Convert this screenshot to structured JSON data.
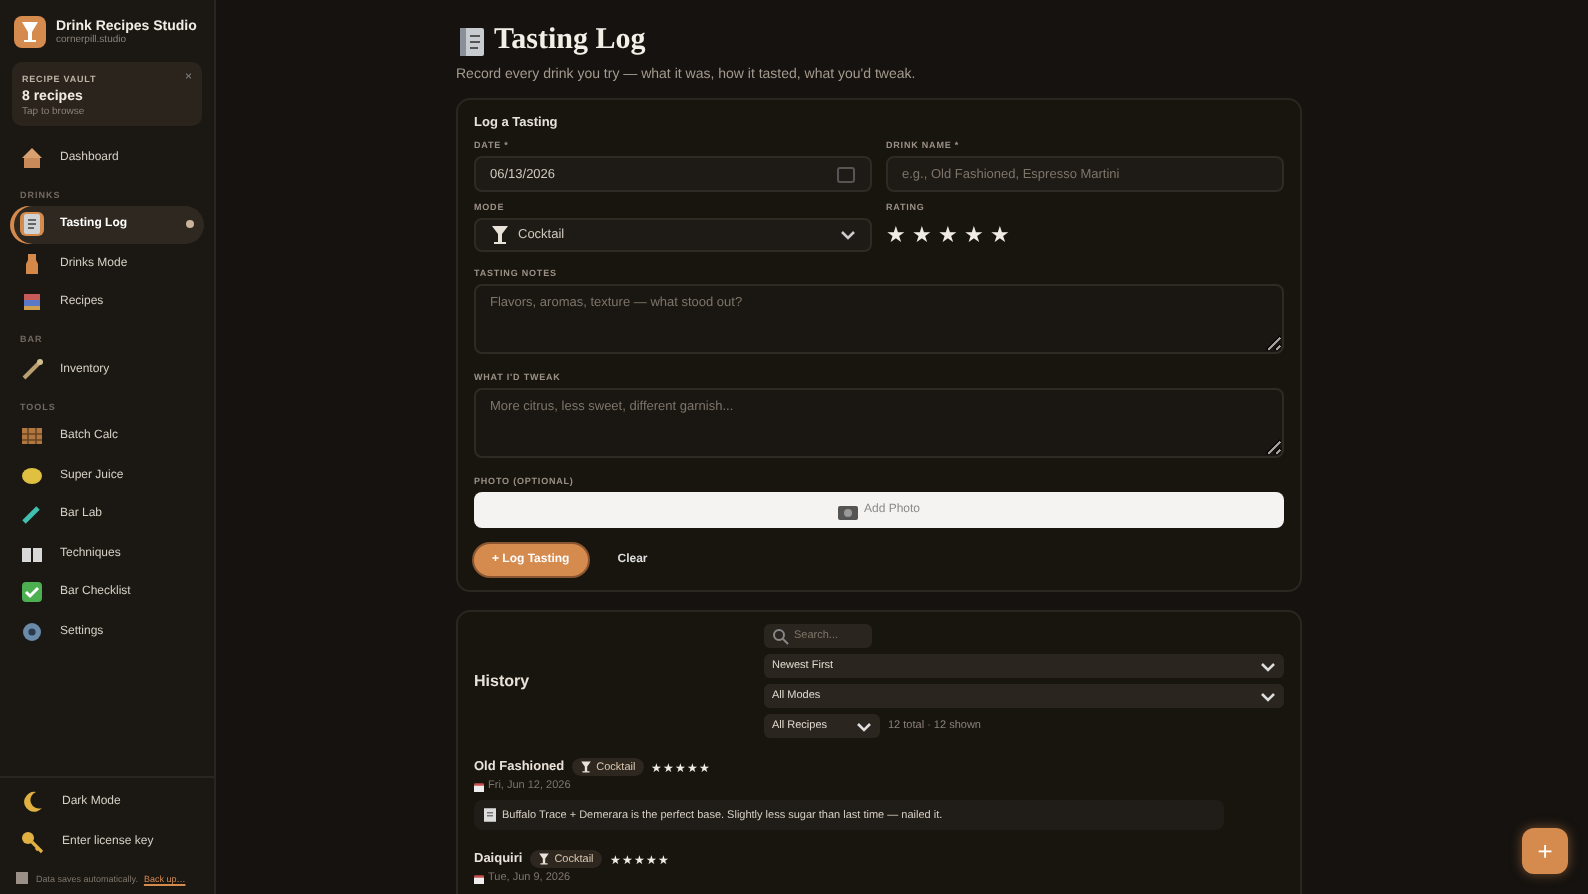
{
  "app": {
    "name": "Drink Recipes Studio",
    "subtitle": "cornerpill.studio"
  },
  "vault": {
    "label": "RECIPE VAULT",
    "count": "8 recipes",
    "hint": "Tap to browse",
    "close": "×"
  },
  "nav": [
    {
      "items": [
        {
          "label": "Dashboard",
          "selected": false
        }
      ]
    },
    {
      "heading": "DRINKS",
      "items": [
        {
          "label": "Tasting Log",
          "selected": true
        },
        {
          "label": "Drinks Mode",
          "selected": false
        },
        {
          "label": "Recipes",
          "selected": false
        }
      ]
    },
    {
      "heading": "BAR",
      "items": [
        {
          "label": "Inventory",
          "selected": false
        }
      ]
    },
    {
      "heading": "TOOLS",
      "items": [
        {
          "label": "Batch Calc",
          "selected": false
        },
        {
          "label": "Super Juice",
          "selected": false
        },
        {
          "label": "Bar Lab",
          "selected": false
        },
        {
          "label": "Techniques",
          "selected": false
        },
        {
          "label": "Bar Checklist",
          "selected": false
        },
        {
          "label": "Settings",
          "selected": false
        }
      ]
    }
  ],
  "sidebar_footer": {
    "items": [
      "Dark Mode",
      "Enter license key"
    ],
    "note": "Data saves automatically.",
    "link": "Back up…"
  },
  "page": {
    "title": "Tasting Log",
    "subtitle": "Record every drink you try — what it was, how it tasted, what you'd tweak."
  },
  "form": {
    "title": "Log a Tasting",
    "date": {
      "label": "DATE *",
      "value": "06/13/2026"
    },
    "drink_name": {
      "label": "DRINK NAME *",
      "placeholder": "e.g., Old Fashioned, Espresso Martini"
    },
    "mode": {
      "label": "MODE",
      "value": "Cocktail"
    },
    "rating": {
      "label": "RATING",
      "stars": 5
    },
    "notes": {
      "label": "TASTING NOTES",
      "placeholder": "Flavors, aromas, texture — what stood out?"
    },
    "tweak": {
      "label": "WHAT I'D TWEAK",
      "placeholder": "More citrus, less sweet, different garnish..."
    },
    "photo": {
      "label": "PHOTO (OPTIONAL)",
      "button": "Add Photo"
    },
    "buttons": [
      "+ Log Tasting",
      "Clear"
    ]
  },
  "history": {
    "title": "History",
    "search_placeholder": "Search...",
    "sort": "Newest First",
    "modes": "All Modes",
    "recipes": "All Recipes",
    "count": "12 total · 12 shown",
    "entries": [
      {
        "name": "Old Fashioned",
        "mode": "Cocktail",
        "stars": 5,
        "date": "Fri, Jun 12, 2026",
        "note": "Buffalo Trace + Demerara is the perfect base. Slightly less sugar than last time — nailed it."
      },
      {
        "name": "Daiquiri",
        "mode": "Cocktail",
        "stars": 5,
        "date": "Tue, Jun 9, 2026"
      }
    ]
  },
  "fab": "+"
}
